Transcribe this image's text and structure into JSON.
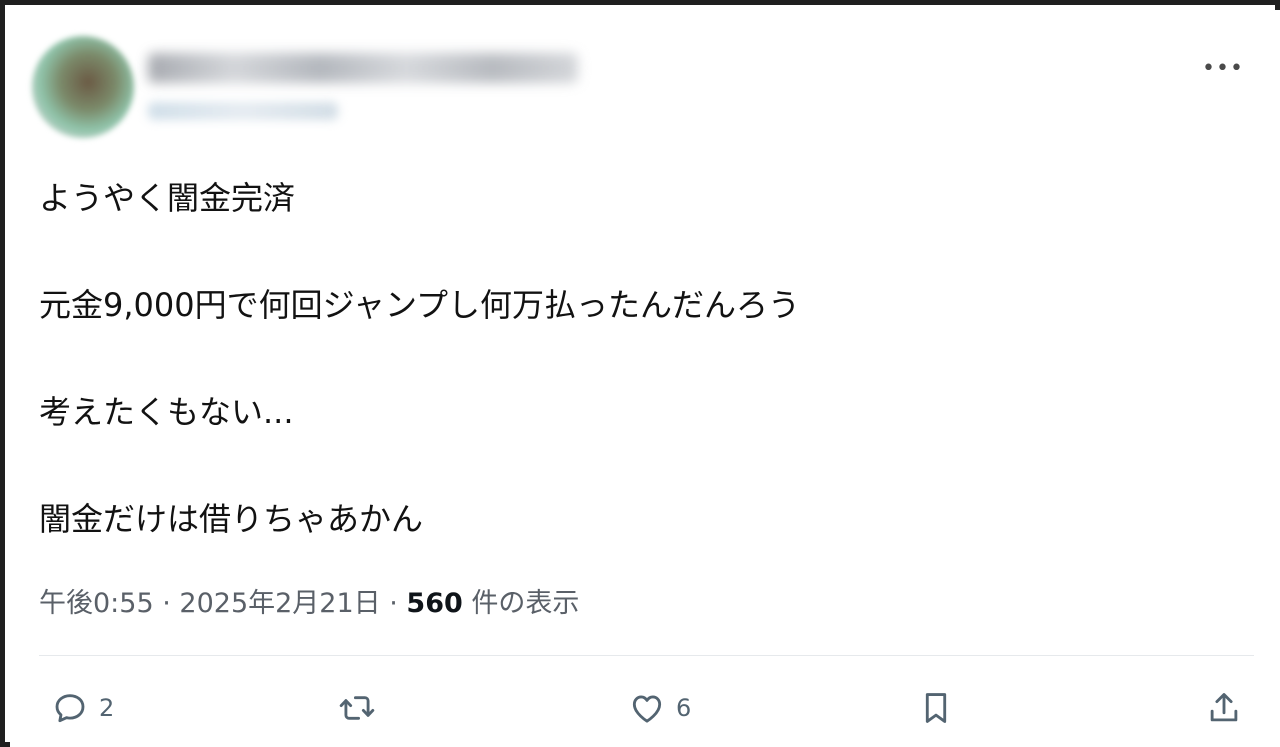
{
  "tweet": {
    "lines": [
      "ようやく闇金完済",
      "元金9,000円で何回ジャンプし何万払ったんだんろう",
      "考えたくもない...",
      "闇金だけは借りちゃあかん"
    ],
    "time": "午後0:55",
    "date": "2025年2月21日",
    "views_count": "560",
    "views_label": "件の表示"
  },
  "actions": {
    "reply_count": "2",
    "like_count": "6"
  },
  "icons": {
    "more": "more-horizontal-icon",
    "reply": "reply-icon",
    "retweet": "retweet-icon",
    "like": "heart-icon",
    "bookmark": "bookmark-icon",
    "share": "share-icon"
  }
}
